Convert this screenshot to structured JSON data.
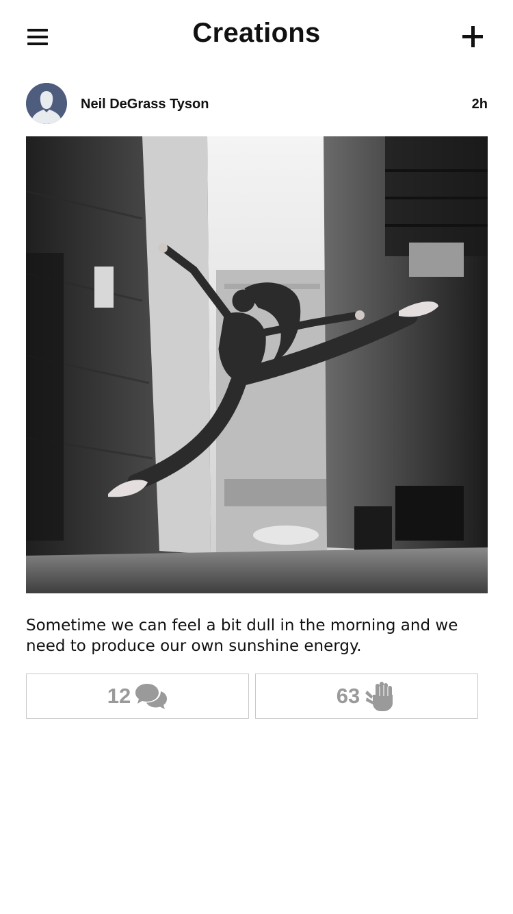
{
  "header": {
    "title": "Creations",
    "menu_icon": "hamburger-menu-icon",
    "add_icon": "plus-icon"
  },
  "post": {
    "author_name": "Neil DeGrass Tyson",
    "time_ago": "2h",
    "avatar_icon": "default-avatar-icon",
    "caption": "Sometime we can feel a bit dull in the morning and we need to produce our own sunshine energy.",
    "comments": {
      "count": "12",
      "icon": "comments-icon"
    },
    "claps": {
      "count": "63",
      "icon": "clap-icon"
    }
  },
  "colors": {
    "avatar_bg": "#4e5d7e",
    "stat_text": "#9a9a9a",
    "stat_border": "#c8c8c8"
  }
}
